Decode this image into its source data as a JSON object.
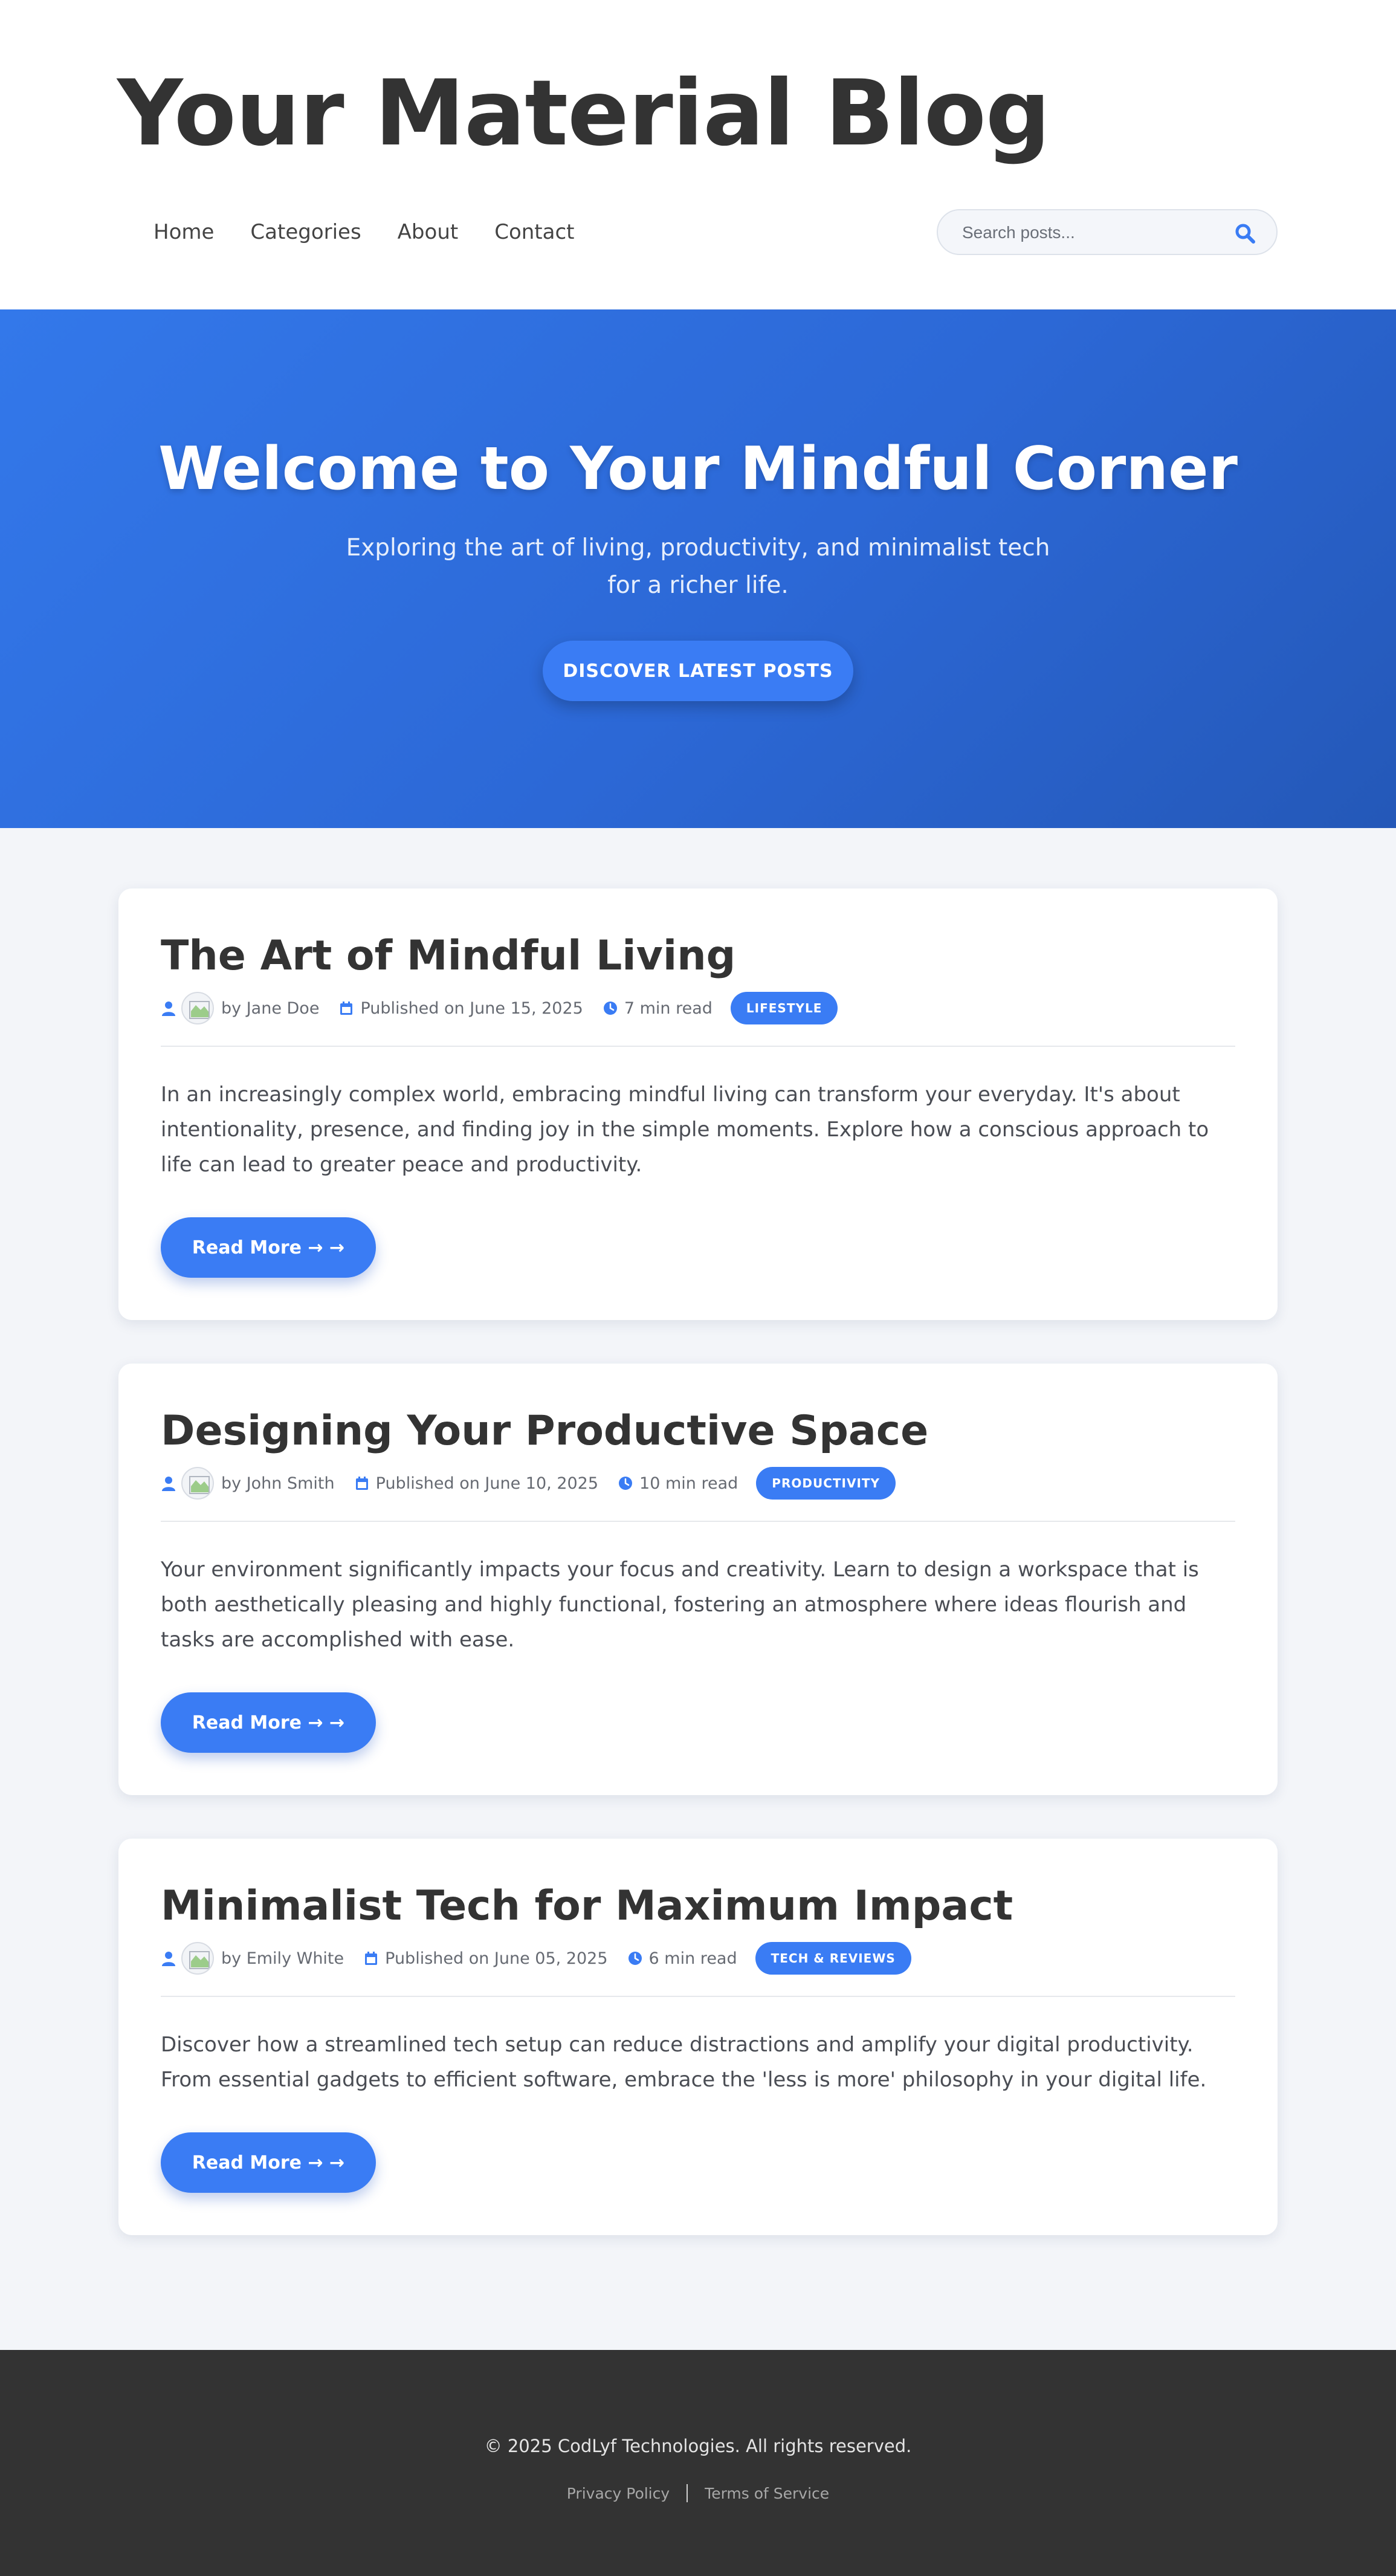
{
  "header": {
    "title": "Your Material Blog",
    "nav": [
      "Home",
      "Categories",
      "About",
      "Contact"
    ],
    "search_placeholder": "Search posts..."
  },
  "hero": {
    "title": "Welcome to Your Mindful Corner",
    "subtitle": "Exploring the art of living, productivity, and minimalist tech for a richer life.",
    "button": "DISCOVER LATEST POSTS"
  },
  "posts": [
    {
      "title": "The Art of Mindful Living",
      "author": "by Jane Doe",
      "date": "Published on June 15, 2025",
      "read_time": "7 min read",
      "tag": "LIFESTYLE",
      "excerpt": "In an increasingly complex world, embracing mindful living can transform your everyday. It's about intentionality, presence, and finding joy in the simple moments. Explore how a conscious approach to life can lead to greater peace and productivity.",
      "button": "Read More → →"
    },
    {
      "title": "Designing Your Productive Space",
      "author": "by John Smith",
      "date": "Published on June 10, 2025",
      "read_time": "10 min read",
      "tag": "PRODUCTIVITY",
      "excerpt": "Your environment significantly impacts your focus and creativity. Learn to design a workspace that is both aesthetically pleasing and highly functional, fostering an atmosphere where ideas flourish and tasks are accomplished with ease.",
      "button": "Read More → →"
    },
    {
      "title": "Minimalist Tech for Maximum Impact",
      "author": "by Emily White",
      "date": "Published on June 05, 2025",
      "read_time": "6 min read",
      "tag": "TECH & REVIEWS",
      "excerpt": "Discover how a streamlined tech setup can reduce distractions and amplify your digital productivity. From essential gadgets to efficient software, embrace the 'less is more' philosophy in your digital life.",
      "button": "Read More → →"
    }
  ],
  "footer": {
    "copyright": "© 2025 CodLyf Technologies. All rights reserved.",
    "links": [
      "Privacy Policy",
      "Terms of Service"
    ]
  },
  "colors": {
    "accent": "#3a7cf4",
    "hero_start": "#3378ea",
    "hero_end": "#2458b8",
    "footer_bg": "#333333",
    "page_bg": "#f3f5f9"
  },
  "icons": [
    "search-icon",
    "user-icon",
    "avatar-broken-image",
    "calendar-icon",
    "clock-icon"
  ]
}
